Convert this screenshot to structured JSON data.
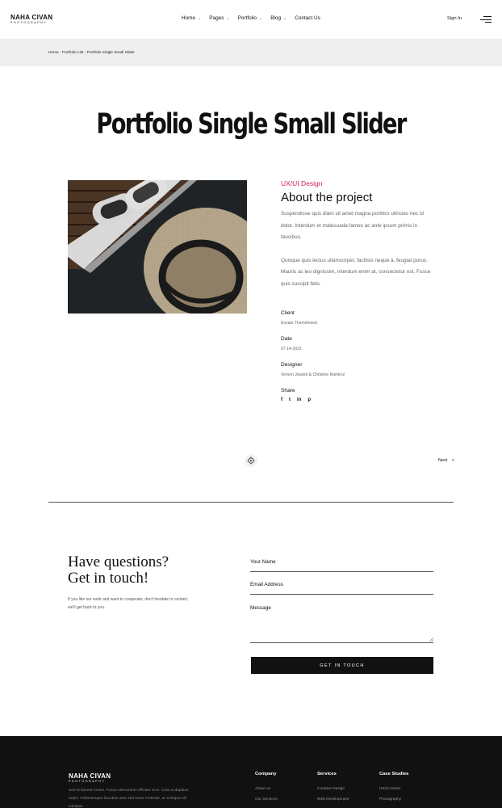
{
  "brand": {
    "name": "NAHA CIVAN",
    "tagline": "PHOTOGRAPHY"
  },
  "nav": {
    "items": [
      {
        "label": "Home",
        "has_dropdown": true
      },
      {
        "label": "Pages",
        "has_dropdown": true
      },
      {
        "label": "Portfolio",
        "has_dropdown": true
      },
      {
        "label": "Blog",
        "has_dropdown": true
      },
      {
        "label": "Contact Us",
        "has_dropdown": false
      }
    ],
    "signin": "Sign In",
    "menu_icon": "hamburger-icon"
  },
  "breadcrumb": "Home - Portfolio List - Portfolio Single Small Slider",
  "page_title": "Portfolio Single Small Slider",
  "project": {
    "category": "UX/UI Design",
    "heading": "About the project",
    "paragraph1": "Suspendisse quis diam sit amet magna porttitor ultricies nec id dolor. Interdum et malesuada fames ac ante ipsum primis in faucibus.",
    "paragraph2": "Quisque quis lectus ullamcorper, facilisis neque a, feugiat purus. Mauris ac leo dignissim, interdum enim at, consectetur est. Fusce quis suscipit felis.",
    "client_label": "Client",
    "client_value": "Envato Themeforest",
    "date_label": "Date",
    "date_value": "07-14-2022",
    "designer_label": "Designer",
    "designer_value": "Vernon Joseph & Christine Ramirez",
    "share_label": "Share",
    "share_icons": [
      "f",
      "t",
      "in",
      "p"
    ]
  },
  "post_nav": {
    "next": "Next",
    "next_arrow": ">"
  },
  "contact": {
    "heading_line1": "Have questions?",
    "heading_line2": "Get in touch!",
    "text": "If you like our work and want to cooperate, don't hesitate to contact, we'll get back to you.",
    "name_label": "Your Name",
    "email_label": "Email Address",
    "message_label": "Message",
    "submit_label": "GET IN TOUCH"
  },
  "footer": {
    "brand_name": "NAHA CIVAN",
    "brand_tagline": "PHOTOGRAPHY",
    "text": "Sed id laoreet metus. Fusce elementum efficitur eros. Cras at dapibus turpis. Pellentesque faucibus ante sed tortor molestie, ac tristique elit volutpat.",
    "columns": [
      {
        "title": "Company",
        "links": [
          "About us",
          "Our Services"
        ]
      },
      {
        "title": "Services",
        "links": [
          "Creative Design",
          "Web Development"
        ]
      },
      {
        "title": "Case Studies",
        "links": [
          "UX/UI Desin",
          "Photography"
        ]
      }
    ]
  },
  "colors": {
    "accent": "#d11f5e",
    "dark": "#111111",
    "crumb_bg": "#efefef"
  }
}
